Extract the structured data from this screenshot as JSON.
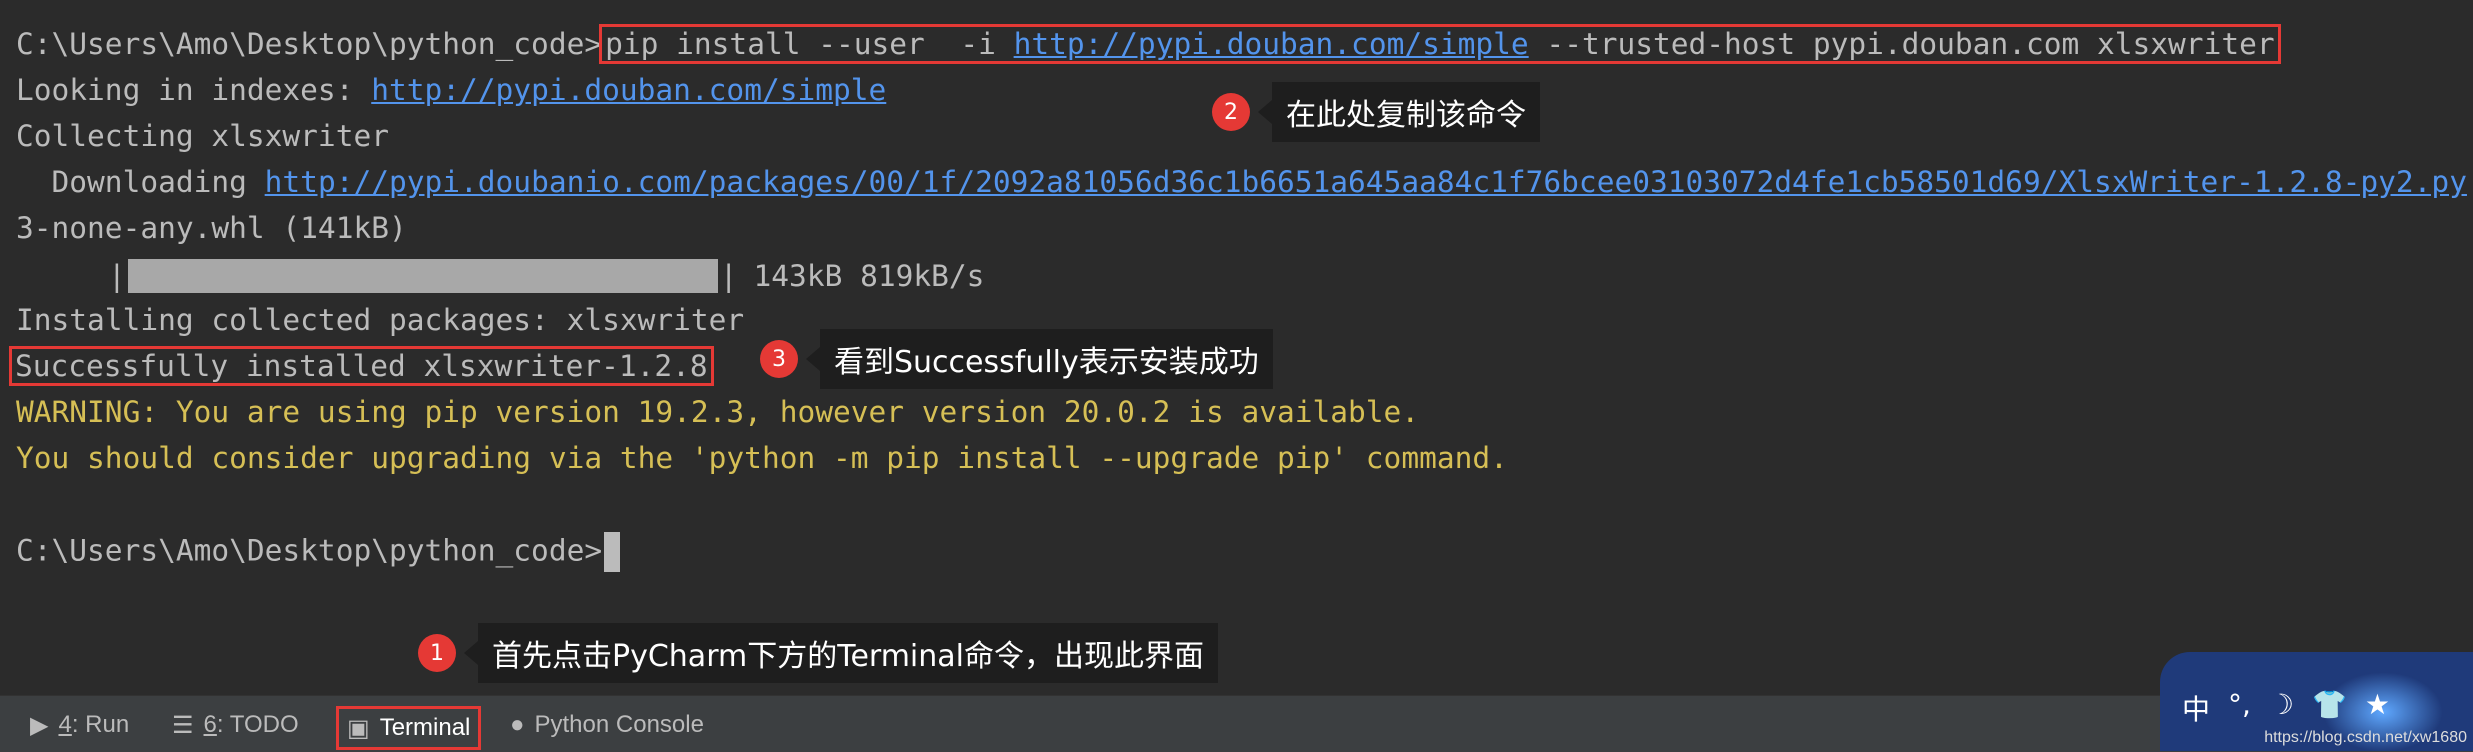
{
  "terminal": {
    "prompt": "C:\\Users\\Amo\\Desktop\\python_code>",
    "command": {
      "pre": "pip install --user  -i ",
      "url": "http://pypi.douban.com/simple",
      "post": " --trusted-host pypi.douban.com xlsxwriter"
    },
    "looking_label": "Looking in indexes: ",
    "looking_url": "http://pypi.douban.com/simple",
    "collecting": "Collecting xlsxwriter",
    "downloading_label": "  Downloading ",
    "downloading_url": "http://pypi.doubanio.com/packages/00/1f/2092a81056d36c1b6651a645aa84c1f76bcee03103072d4fe1cb58501d69/XlsxWriter-1.2.8-py2.py",
    "wheel_line": "3-none-any.whl (141kB)",
    "progress": {
      "fraction": 1.0,
      "text": "143kB 819kB/s"
    },
    "installing": "Installing collected packages: xlsxwriter",
    "success": "Successfully installed xlsxwriter-1.2.8",
    "warning1": "WARNING: You are using pip version 19.2.3, however version 20.0.2 is available.",
    "warning2": "You should consider upgrading via the 'python -m pip install --upgrade pip' command.",
    "final_prompt": "C:\\Users\\Amo\\Desktop\\python_code>"
  },
  "annotations": [
    {
      "num": "1",
      "text": "首先点击PyCharm下方的Terminal命令，出现此界面"
    },
    {
      "num": "2",
      "text": "在此处复制该命令"
    },
    {
      "num": "3",
      "text": "看到Successfully表示安装成功"
    }
  ],
  "toolbar": {
    "run": {
      "key": "4",
      "label": ": Run"
    },
    "todo": {
      "key": "6",
      "label": ": TODO"
    },
    "terminal": "Terminal",
    "python_console": "Python Console"
  },
  "widget": {
    "icons": [
      "中",
      "°,",
      "☽",
      "👕",
      "★"
    ],
    "url": "https://blog.csdn.net/xw1680"
  },
  "colors": {
    "background": "#2b2b2b",
    "text": "#bbbbbb",
    "link": "#5394ec",
    "warning": "#d6bf55",
    "highlight": "#e53935"
  }
}
